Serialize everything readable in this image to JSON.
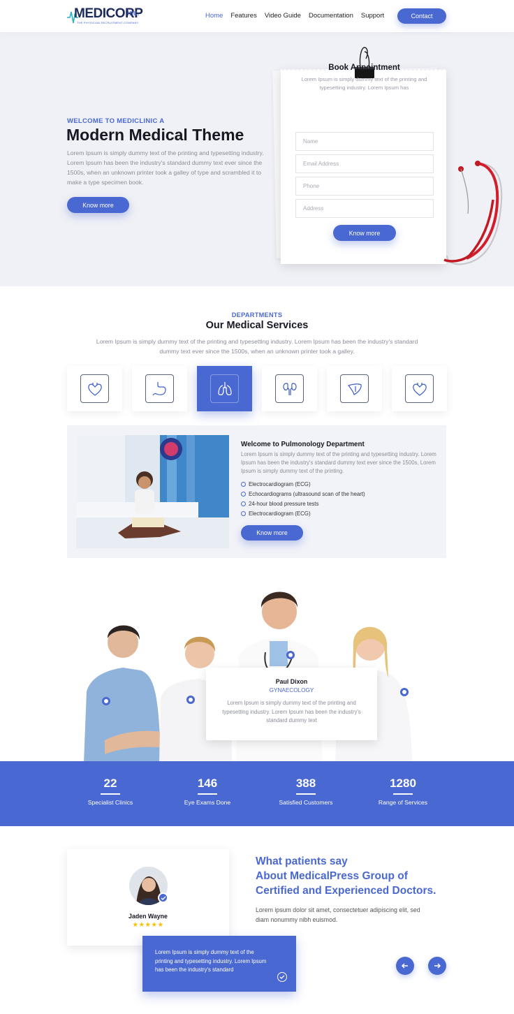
{
  "brand": {
    "name": "MEDICORP",
    "suffix": "Inc.",
    "tagline": "THE PHYSICIAN RECRUITMENT COMPANY",
    "accent": "#4a68d1"
  },
  "nav": {
    "items": [
      "Home",
      "Features",
      "Video Guide",
      "Documentation",
      "Support"
    ],
    "active": "Home",
    "contact_label": "Contact"
  },
  "hero": {
    "kicker": "WELCOME TO MEDICLINIC A",
    "title": "Modern Medical Theme",
    "text": "Lorem Ipsum is simply dummy text of the printing and typesetting industry. Lorem Ipsum has been the industry's standard dummy text ever since the 1500s, when an unknown printer took a galley of type and scrambled it to make a type specimen book.",
    "button": "Know more"
  },
  "appointment": {
    "title": "Book Appointment",
    "subtitle": "Lorem Ipsum is simply dummy text of the printing and typesetting industry. Lorem Ipsum has",
    "fields": {
      "name": "Name",
      "email": "Email Address",
      "phone": "Phone",
      "address": "Address"
    },
    "button": "Know more"
  },
  "departments": {
    "kicker": "DEPARTMENTS",
    "title": "Our Medical Services",
    "text": "Lorem Ipsum is simply dummy text of the printing and typesetting industry. Lorem Ipsum has been the industry's standard dummy text ever since the 1500s, when an unknown printer took a galley.",
    "icons": [
      "heart-icon",
      "stomach-icon",
      "lungs-icon",
      "kidneys-icon",
      "liver-icon",
      "heart-icon"
    ],
    "active_index": 2,
    "detail": {
      "title": "Welcome to Pulmonology Department",
      "text": "Lorem Ipsum is simply dummy text of the printing and typesetting industry. Lorem Ipsum has been the industry's standard dummy text ever since the 1500s, Lorem Ipsum is simply dummy text of the printing.",
      "items": [
        "Electrocardiogram (ECG)",
        "Echocardiograms (ultrasound scan of the heart)",
        "24-hour blood pressure tests",
        "Electrocardiogram (ECG)"
      ],
      "button": "Know more"
    }
  },
  "team": {
    "name": "Paul Dixon",
    "role": "GYNAECOLOGY",
    "text": "Lorem Ipsum is simply dummy text of the printing and typesetting industry. Lorem Ipsum has been the industry's standard dummy text"
  },
  "stats": [
    {
      "value": "22",
      "label": "Specialist Clinics"
    },
    {
      "value": "146",
      "label": "Eye Exams Done"
    },
    {
      "value": "388",
      "label": "Satisfied Customers"
    },
    {
      "value": "1280",
      "label": "Range of Services"
    }
  ],
  "testimonial": {
    "name": "Jaden Wayne",
    "stars": "★★★★★",
    "rating": 5,
    "quote": "Lorem Ipsum is simply dummy text of the printing and typesetting industry. Lorem Ipsum has been the industry's standard",
    "heading_line1": "What patients say",
    "heading_line2": "About MedicalPress Group of",
    "heading_line3": "Certified and Experienced Doctors.",
    "subtext": "Lorem ipsum dolor sit amet, consectetuer adipiscing elit, sed diam nonummy nibh euismod.",
    "prev_icon": "arrow-left-icon",
    "next_icon": "arrow-right-icon"
  }
}
